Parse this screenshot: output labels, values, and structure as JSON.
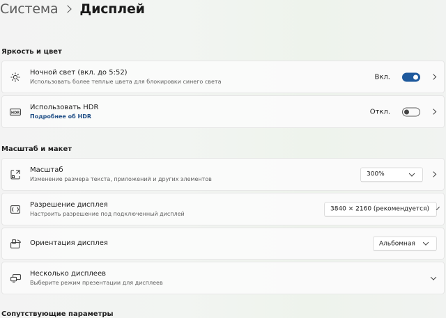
{
  "breadcrumb": {
    "parent": "Система",
    "current": "Дисплей"
  },
  "sections": {
    "brightness": "Яркость и цвет",
    "scale_layout": "Масштаб и макет",
    "related": "Сопутствующие параметры"
  },
  "night_light": {
    "title": "Ночной свет (вкл. до 5:52)",
    "subtitle": "Использовать более теплые цвета для блокировки синего света",
    "state_label": "Вкл.",
    "on": true,
    "icon": "sun-brightness-icon"
  },
  "hdr": {
    "title": "Использовать HDR",
    "link": "Подробнее об HDR",
    "state_label": "Откл.",
    "on": false,
    "icon": "hdr-icon"
  },
  "scale": {
    "title": "Масштаб",
    "subtitle": "Изменение размера текста, приложений и других элементов",
    "value": "300%",
    "icon": "scale-icon"
  },
  "resolution": {
    "title": "Разрешение дисплея",
    "subtitle": "Настроить разрешение под подключенный дисплей",
    "value": "3840 × 2160 (рекомендуется)",
    "icon": "resolution-icon"
  },
  "orientation": {
    "title": "Ориентация дисплея",
    "value": "Альбомная",
    "icon": "orientation-icon"
  },
  "multiple": {
    "title": "Несколько дисплеев",
    "subtitle": "Выберите режим презентации для дисплеев",
    "icon": "multiple-displays-icon"
  },
  "colors": {
    "accent": "#1f5a9d",
    "link": "#1f4e86"
  }
}
